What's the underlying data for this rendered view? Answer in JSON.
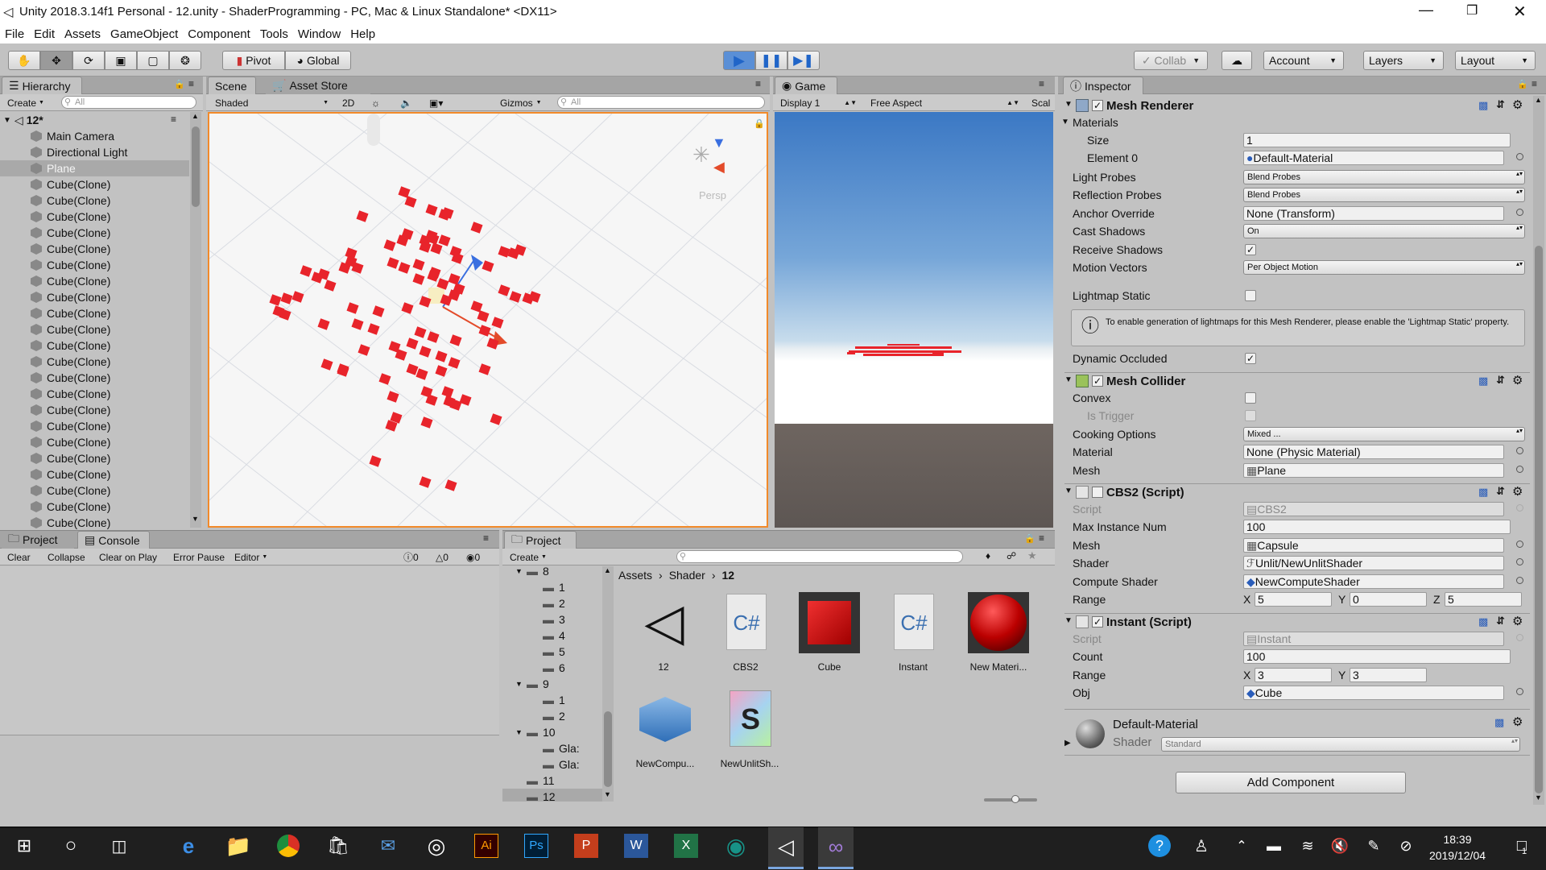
{
  "window": {
    "title": "Unity 2018.3.14f1 Personal - 12.unity - ShaderProgramming - PC, Mac & Linux Standalone* <DX11>"
  },
  "menu": [
    "File",
    "Edit",
    "Assets",
    "GameObject",
    "Component",
    "Tools",
    "Window",
    "Help"
  ],
  "toolbar": {
    "pivot": "Pivot",
    "global": "Global",
    "collab": "Collab",
    "account": "Account",
    "layers": "Layers",
    "layout": "Layout"
  },
  "hierarchy": {
    "tab": "Hierarchy",
    "create": "Create",
    "search": "All",
    "scene": "12*",
    "items": [
      "Main Camera",
      "Directional Light",
      "Plane",
      "Cube(Clone)",
      "Cube(Clone)",
      "Cube(Clone)",
      "Cube(Clone)",
      "Cube(Clone)",
      "Cube(Clone)",
      "Cube(Clone)",
      "Cube(Clone)",
      "Cube(Clone)",
      "Cube(Clone)",
      "Cube(Clone)",
      "Cube(Clone)",
      "Cube(Clone)",
      "Cube(Clone)",
      "Cube(Clone)",
      "Cube(Clone)",
      "Cube(Clone)",
      "Cube(Clone)",
      "Cube(Clone)",
      "Cube(Clone)",
      "Cube(Clone)",
      "Cube(Clone)"
    ]
  },
  "scene": {
    "tab_scene": "Scene",
    "tab_store": "Asset Store",
    "shaded": "Shaded",
    "mode2d": "2D",
    "gizmos": "Gizmos",
    "search": "All",
    "persp": "Persp"
  },
  "game": {
    "tab": "Game",
    "display": "Display 1",
    "aspect": "Free Aspect",
    "scale": "Scal"
  },
  "console": {
    "tab_project": "Project",
    "tab_console": "Console",
    "clear": "Clear",
    "collapse": "Collapse",
    "clear_on_play": "Clear on Play",
    "error_pause": "Error Pause",
    "editor": "Editor",
    "count_log": "0",
    "count_warn": "0",
    "count_err": "0"
  },
  "project": {
    "tab": "Project",
    "create": "Create",
    "breadcrumb": [
      "Assets",
      "Shader",
      "12"
    ],
    "tree": [
      "8",
      "1",
      "2",
      "3",
      "4",
      "5",
      "6",
      "9",
      "1",
      "2",
      "10",
      "Gla:",
      "Gla:",
      "11",
      "12"
    ],
    "assets": [
      "12",
      "CBS2",
      "Cube",
      "Instant",
      "New Materi...",
      "NewCompu...",
      "NewUnlitSh..."
    ]
  },
  "inspector": {
    "tab": "Inspector",
    "mesh_renderer": {
      "title": "Mesh Renderer",
      "materials": "Materials",
      "size_label": "Size",
      "size": "1",
      "element_label": "Element 0",
      "element": "Default-Material",
      "light_probes_label": "Light Probes",
      "light_probes": "Blend Probes",
      "reflection_label": "Reflection Probes",
      "reflection": "Blend Probes",
      "anchor_label": "Anchor Override",
      "anchor": "None (Transform)",
      "cast_label": "Cast Shadows",
      "cast": "On",
      "receive_label": "Receive Shadows",
      "motion_label": "Motion Vectors",
      "motion": "Per Object Motion",
      "lightmap_label": "Lightmap Static",
      "help": "To enable generation of lightmaps for this Mesh Renderer, please enable the 'Lightmap Static' property.",
      "occluded_label": "Dynamic Occluded"
    },
    "mesh_collider": {
      "title": "Mesh Collider",
      "convex": "Convex",
      "trigger": "Is Trigger",
      "cooking_label": "Cooking Options",
      "cooking": "Mixed ...",
      "material_label": "Material",
      "material": "None (Physic Material)",
      "mesh_label": "Mesh",
      "mesh": "Plane"
    },
    "cbs2": {
      "title": "CBS2 (Script)",
      "script_label": "Script",
      "script": "CBS2",
      "max_label": "Max Instance Num",
      "max": "100",
      "mesh_label": "Mesh",
      "mesh": "Capsule",
      "shader_label": "Shader",
      "shader": "Unlit/NewUnlitShader",
      "compute_label": "Compute Shader",
      "compute": "NewComputeShader",
      "range_label": "Range",
      "x": "5",
      "y": "0",
      "z": "5"
    },
    "instant": {
      "title": "Instant (Script)",
      "script_label": "Script",
      "script": "Instant",
      "count_label": "Count",
      "count": "100",
      "range_label": "Range",
      "x": "3",
      "y": "3",
      "obj_label": "Obj",
      "obj": "Cube"
    },
    "material": {
      "name": "Default-Material",
      "shader_label": "Shader",
      "shader": "Standard"
    },
    "add_component": "Add Component",
    "axis": {
      "x": "X",
      "y": "Y",
      "z": "Z"
    }
  },
  "taskbar": {
    "time": "18:39",
    "date": "2019/12/04",
    "notif": "1"
  }
}
